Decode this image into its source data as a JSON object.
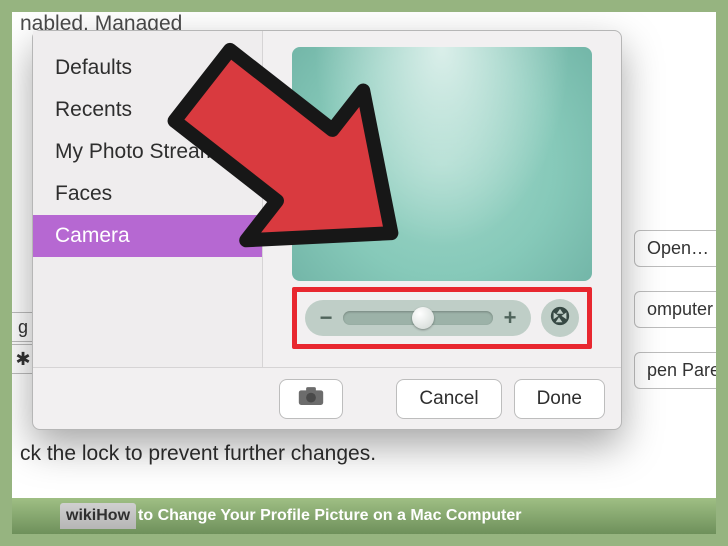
{
  "background": {
    "top_text": "nabled, Managed",
    "right_buttons": [
      "Open…",
      "omputer",
      "pen Pare"
    ],
    "left_frag_labels": [
      "g",
      "✱"
    ],
    "lock_text": "ck the lock to prevent further changes."
  },
  "picker": {
    "sidebar": {
      "items": [
        {
          "label": "Defaults",
          "selected": false
        },
        {
          "label": "Recents",
          "selected": false
        },
        {
          "label": "My Photo Stream",
          "selected": false
        },
        {
          "label": "Faces",
          "selected": false
        },
        {
          "label": "Camera",
          "selected": true
        }
      ]
    },
    "zoom": {
      "minus": "−",
      "plus": "+"
    },
    "footer": {
      "cancel": "Cancel",
      "done": "Done"
    }
  },
  "caption": {
    "logo": "wikiHow",
    "text": " to Change Your Profile Picture on a Mac Computer"
  }
}
